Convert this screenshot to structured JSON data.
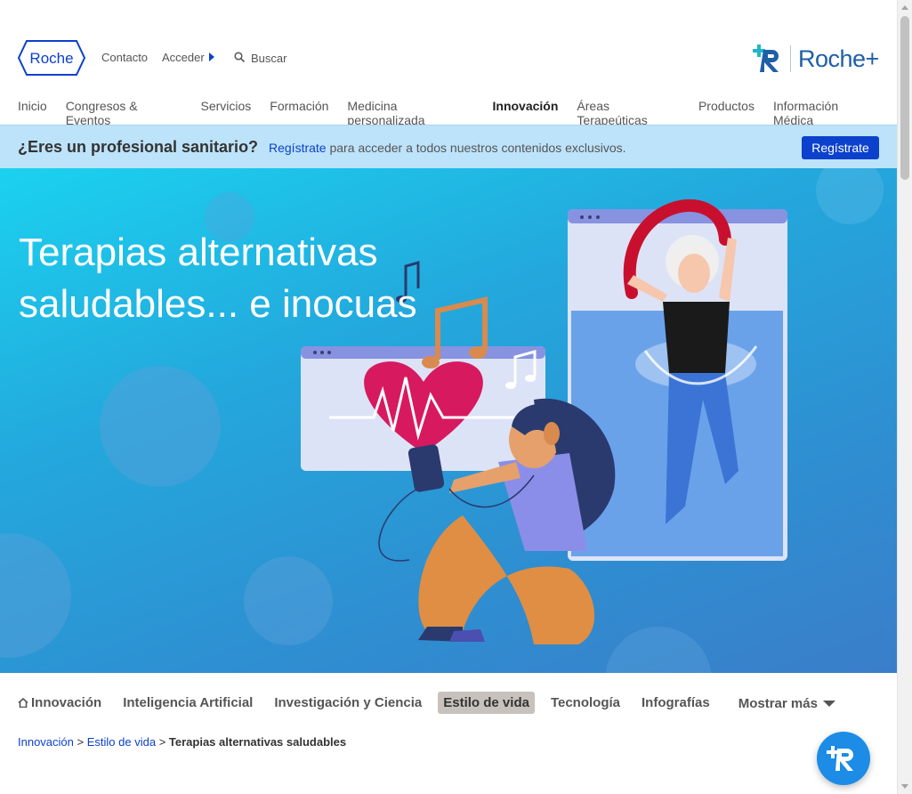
{
  "header": {
    "logo_text": "Roche",
    "contact": "Contacto",
    "login": "Acceder",
    "search": "Buscar",
    "brand_plus": "Roche+"
  },
  "nav": [
    "Inicio",
    "Congresos & Eventos",
    "Servicios",
    "Formación",
    "Medicina personalizada",
    "Innovación",
    "Áreas Terapeúticas",
    "Productos",
    "Información Médica"
  ],
  "nav_active": "Innovación",
  "register": {
    "question": "¿Eres un profesional sanitario?",
    "link": "Regístrate",
    "text": "para acceder a todos nuestros contenidos exclusivos.",
    "button": "Regístrate"
  },
  "hero": {
    "title_line1": "Terapias alternativas",
    "title_line2": "saludables... e inocuas"
  },
  "categories": [
    {
      "label": "Innovación",
      "icon": "home-icon"
    },
    {
      "label": "Inteligencia Artificial"
    },
    {
      "label": "Investigación y Ciencia"
    },
    {
      "label": "Estilo de vida",
      "active": true
    },
    {
      "label": "Tecnología"
    },
    {
      "label": "Infografías"
    },
    {
      "label": "Mostrar más",
      "icon": "chevron-down-icon"
    }
  ],
  "breadcrumb": {
    "level1": "Innovación",
    "level2": "Estilo de vida",
    "current": "Terapias alternativas saludables"
  },
  "colors": {
    "primary": "#0b41cd",
    "banner": "#bde3fa",
    "hero_gradient_start": "#1bd2ef",
    "hero_gradient_end": "#3a7ec9",
    "active_category": "#c8c2bd"
  }
}
